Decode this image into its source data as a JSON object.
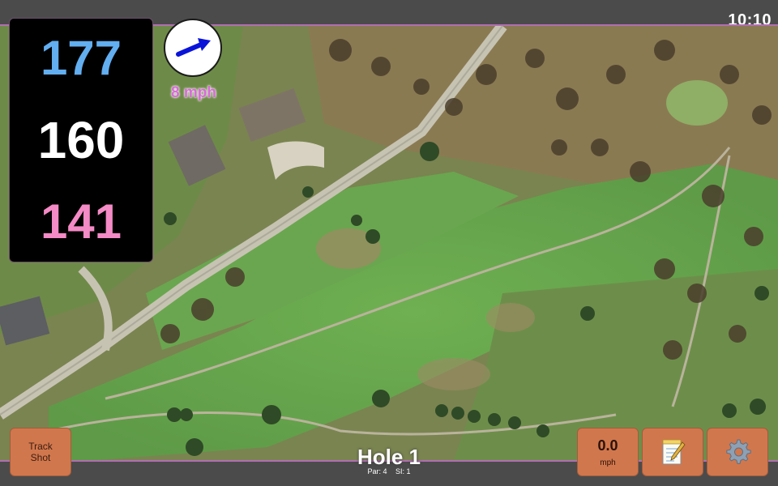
{
  "status": {
    "time": "10:10"
  },
  "distances": {
    "back": "177",
    "middle": "160",
    "front": "141"
  },
  "wind": {
    "speed_label": "8 mph",
    "direction_icon": "arrow-icon"
  },
  "buttons": {
    "track_shot": "Track\nShot",
    "speed_value": "0.0",
    "speed_unit": "mph",
    "notes_icon": "notepad-icon",
    "settings_icon": "gear-icon"
  },
  "hole": {
    "title": "Hole 1",
    "par": "Par: 4",
    "si": "SI: 1"
  },
  "colors": {
    "back_distance": "#62aef0",
    "middle_distance": "#ffffff",
    "front_distance": "#f48ac6",
    "wind_text": "#d96ad8",
    "button_bg": "#d1774d",
    "bar_bg": "#4b4b4b"
  }
}
